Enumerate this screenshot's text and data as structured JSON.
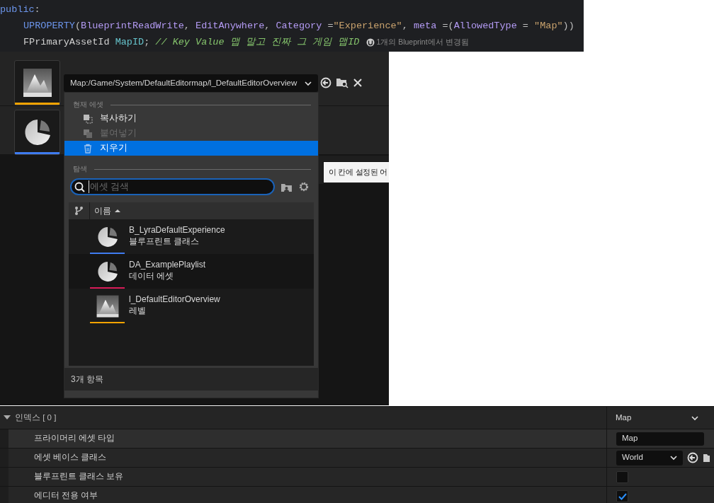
{
  "code_lines": [
    {
      "indent": false,
      "tokens": [
        {
          "kind": "keyword",
          "text": "public"
        },
        {
          "kind": "plain",
          "text": ":"
        }
      ]
    },
    {
      "indent": true,
      "tokens": [
        {
          "kind": "macro",
          "text": "UPROPERTY"
        },
        {
          "kind": "plain",
          "text": "("
        },
        {
          "kind": "param",
          "text": "BlueprintReadWrite"
        },
        {
          "kind": "plain",
          "text": ", "
        },
        {
          "kind": "param",
          "text": "EditAnywhere"
        },
        {
          "kind": "plain",
          "text": ", "
        },
        {
          "kind": "param",
          "text": "Category"
        },
        {
          "kind": "plain",
          "text": " ="
        },
        {
          "kind": "string",
          "text": "\"Experience\""
        },
        {
          "kind": "plain",
          "text": ", "
        },
        {
          "kind": "param",
          "text": "meta"
        },
        {
          "kind": "plain",
          "text": " =("
        },
        {
          "kind": "param",
          "text": "AllowedType"
        },
        {
          "kind": "plain",
          "text": " = "
        },
        {
          "kind": "string",
          "text": "\"Map\""
        },
        {
          "kind": "plain",
          "text": "))"
        }
      ]
    },
    {
      "indent": true,
      "tokens": [
        {
          "kind": "type",
          "text": "FPrimaryAssetId"
        },
        {
          "kind": "field",
          "text": "MapID",
          "space_before": true
        },
        {
          "kind": "plain",
          "text": "; "
        },
        {
          "kind": "comment",
          "text": "// Key Value 맵 말고 진짜 그 게임 맵ID"
        }
      ],
      "hint": "1개의 Blueprint에서 변경됨"
    }
  ],
  "thumbnails": [
    {
      "kind": "map",
      "color": "#f5a300"
    },
    {
      "kind": "blueprint",
      "color": "#3f7cf0"
    }
  ],
  "asset_picker": {
    "path": "Map:/Game/System/DefaultEditormap/l_DefaultEditorOverview",
    "current_section": "현재 에셋",
    "actions": [
      {
        "kind": "copy",
        "label": "복사하기",
        "disabled": false,
        "selected": false
      },
      {
        "kind": "paste",
        "label": "붙여넣기",
        "disabled": true,
        "selected": false
      },
      {
        "kind": "delete",
        "label": "지우기",
        "disabled": false,
        "selected": true
      }
    ],
    "browse_section": "탐색",
    "search": {
      "placeholder": "에셋 검색"
    },
    "column": "이름",
    "assets": [
      {
        "kind": "blueprint",
        "name": "B_LyraDefaultExperience",
        "type": "블루프린트 클래스",
        "color": "#3f7cf0"
      },
      {
        "kind": "blueprint",
        "name": "DA_ExamplePlaylist",
        "type": "데이터 에셋",
        "color": "#d81b58"
      },
      {
        "kind": "map",
        "name": "l_DefaultEditorOverview",
        "type": "레벨",
        "color": "#f5a300"
      }
    ],
    "count": "3개 항목"
  },
  "tooltip": "이 칸에 설정된 어",
  "details": {
    "header": "인덱스 [ 0 ]",
    "header_value": "Map",
    "expanded": true,
    "rows": [
      {
        "kind": "text",
        "label": "프라이머리 에셋 타입",
        "value": "Map"
      },
      {
        "kind": "combo",
        "label": "에셋 베이스 클래스",
        "value": "World"
      },
      {
        "kind": "checkbox",
        "label": "블루프린트 클래스 보유",
        "checked": false
      },
      {
        "kind": "checkbox",
        "label": "에디터 전용 여부",
        "checked": true
      }
    ]
  }
}
